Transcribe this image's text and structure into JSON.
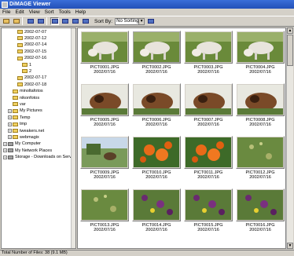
{
  "window": {
    "title": "DiMAGE Viewer"
  },
  "menu": [
    "File",
    "Edit",
    "View",
    "Sort",
    "Tools",
    "Help"
  ],
  "toolbar": {
    "sort_label": "Sort By:",
    "sort_value": "No Sorting"
  },
  "tree": [
    {
      "label": "2002-07-07",
      "level": 3
    },
    {
      "label": "2002-07-12",
      "level": 3
    },
    {
      "label": "2002-07-14",
      "level": 3
    },
    {
      "label": "2002-07-15",
      "level": 3
    },
    {
      "label": "2002-07-16",
      "level": 3
    },
    {
      "label": "1",
      "level": 4
    },
    {
      "label": "2",
      "level": 4
    },
    {
      "label": "2002-07-17",
      "level": 3
    },
    {
      "label": "2002-07-18",
      "level": 3
    },
    {
      "label": "minoltafotos",
      "level": 2
    },
    {
      "label": "nikonfotos",
      "level": 2
    },
    {
      "label": "var",
      "level": 2
    },
    {
      "label": "My Pictures",
      "level": 1
    },
    {
      "label": "Temp",
      "level": 1
    },
    {
      "label": "tmp",
      "level": 1
    },
    {
      "label": "tweakers.net",
      "level": 1
    },
    {
      "label": "webmagix",
      "level": 1
    },
    {
      "label": "My Computer",
      "level": 0
    },
    {
      "label": "My Network Places",
      "level": 0
    },
    {
      "label": "Storage - Downloads on Serve",
      "level": 0
    }
  ],
  "thumbnails": [
    {
      "name": "PICT0001.JPG",
      "date": "2002/07/16",
      "scene": "goat"
    },
    {
      "name": "PICT0002.JPG",
      "date": "2002/07/16",
      "scene": "goat"
    },
    {
      "name": "PICT0003.JPG",
      "date": "2002/07/16",
      "scene": "goat"
    },
    {
      "name": "PICT0004.JPG",
      "date": "2002/07/16",
      "scene": "goat"
    },
    {
      "name": "PICT0005.JPG",
      "date": "2002/07/16",
      "scene": "horse"
    },
    {
      "name": "PICT0006.JPG",
      "date": "2002/07/16",
      "scene": "horse"
    },
    {
      "name": "PICT0007.JPG",
      "date": "2002/07/16",
      "scene": "horse"
    },
    {
      "name": "PICT0008.JPG",
      "date": "2002/07/16",
      "scene": "horse"
    },
    {
      "name": "PICT0009.JPG",
      "date": "2002/07/16",
      "scene": "field"
    },
    {
      "name": "PICT0010.JPG",
      "date": "2002/07/16",
      "scene": "flower-orange"
    },
    {
      "name": "PICT0011.JPG",
      "date": "2002/07/16",
      "scene": "flower-orange"
    },
    {
      "name": "PICT0012.JPG",
      "date": "2002/07/16",
      "scene": "grass"
    },
    {
      "name": "PICT0013.JPG",
      "date": "2002/07/16",
      "scene": "grass"
    },
    {
      "name": "PICT0014.JPG",
      "date": "2002/07/16",
      "scene": "flower-purple"
    },
    {
      "name": "PICT0015.JPG",
      "date": "2002/07/16",
      "scene": "flower-purple"
    },
    {
      "name": "PICT0016.JPG",
      "date": "2002/07/16",
      "scene": "flower-purple"
    }
  ],
  "selected_index": 1,
  "status": {
    "text": "Total Number of Files: 38 (9.1 MB)"
  }
}
